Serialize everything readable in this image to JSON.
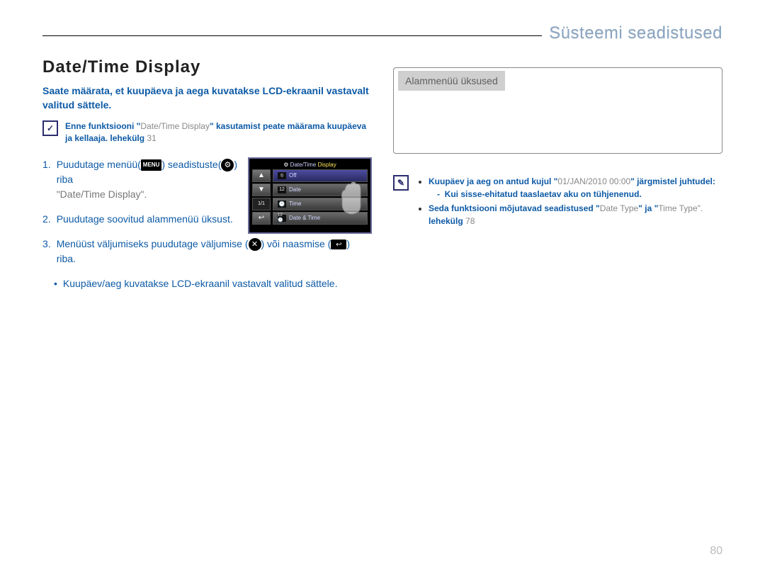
{
  "header": {
    "section": "Süsteemi seadistused"
  },
  "title": "Date/Time Display",
  "lead": "Saate määrata, et kuupäeva ja aega kuvatakse LCD-ekraanil vastavalt valitud sättele.",
  "precheck": {
    "text_a": "Enne funktsiooni \"",
    "term": "Date/Time Display",
    "text_b": "\" kasutamist peate määrama kuupäeva ja kellaaja.",
    "page_label": "lehekülg",
    "page": "31"
  },
  "steps": {
    "s1": {
      "a": "Puudutage menüü(",
      "menu_icon": "MENU",
      "b": ") seadistuste(",
      "gear_icon": "⚙",
      "c": ") riba",
      "q_open": "\"",
      "term": "Date/Time Display",
      "q_close": "\"."
    },
    "s2": "Puudutage soovitud alammenüü üksust.",
    "s3": {
      "a": "Menüüst väljumiseks puudutage väljumise (",
      "x_icon": "✕",
      "b": ") või naasmise (",
      "back_icon": "↩",
      "c": ") riba."
    },
    "bullet": "Kuupäev/aeg kuvatakse LCD-ekraanil vastavalt valitud sättele."
  },
  "shot": {
    "title_a": "Date/Time ",
    "title_b": "Display",
    "r1": {
      "icon": "⦸",
      "label": "Off"
    },
    "r2": {
      "icon": "12",
      "label": "Date"
    },
    "r3": {
      "icon": "🕒",
      "label": "Time"
    },
    "r4": {
      "icon": "12🕒",
      "label": "Date & Time"
    },
    "side_counter": "1/1",
    "side_back": "↩"
  },
  "right": {
    "box_head": "Alammenüü üksused",
    "n1_a": "Kuupäev ja aeg on antud kujul \"",
    "n1_term": "01/JAN/2010 00:00",
    "n1_b": "\" järgmistel juhtudel:",
    "n1_sub": "Kui sisse-ehitatud taaslaetav aku on tühjenenud.",
    "n2_a": "Seda funktsiooni mõjutavad seadistused \"",
    "n2_term1": "Date Type",
    "n2_mid": "\" ja \"",
    "n2_term2": "Time Type",
    "n2_b": "\".",
    "page_label": "lehekülg",
    "page": "78"
  },
  "page_num": "80"
}
